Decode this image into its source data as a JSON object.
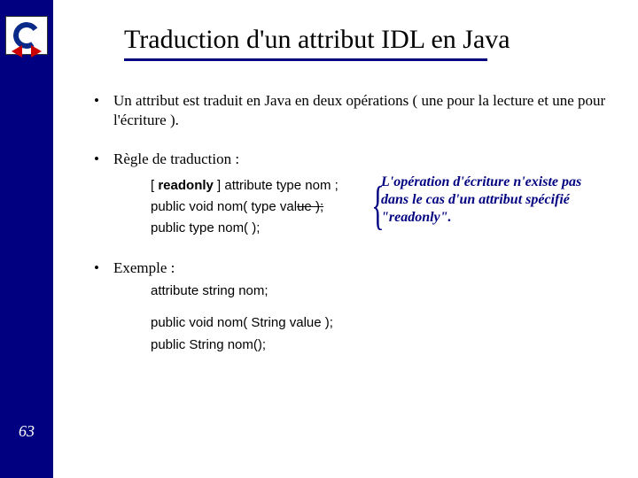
{
  "page_number": "63",
  "title": "Traduction d'un attribut IDL en Java",
  "bullets": {
    "b1": "Un attribut est traduit en Java en deux opérations ( une pour la lecture et une pour l'écriture ).",
    "b2": "Règle de traduction :",
    "b3": "Exemple :"
  },
  "rule_code": {
    "l1_open": "[ ",
    "l1_kw": "readonly",
    "l1_rest": " ] attribute type nom ;",
    "l2_pre": "public void nom( type val",
    "l2_strike": "ue );",
    "l3": "public type nom( );"
  },
  "note": "L'opération d'écriture n'existe pas dans le cas d'un attribut spécifié \"readonly\".",
  "example": {
    "e1": "attribute string nom;",
    "e2": "public void nom( String value );",
    "e3": "public String nom();"
  }
}
